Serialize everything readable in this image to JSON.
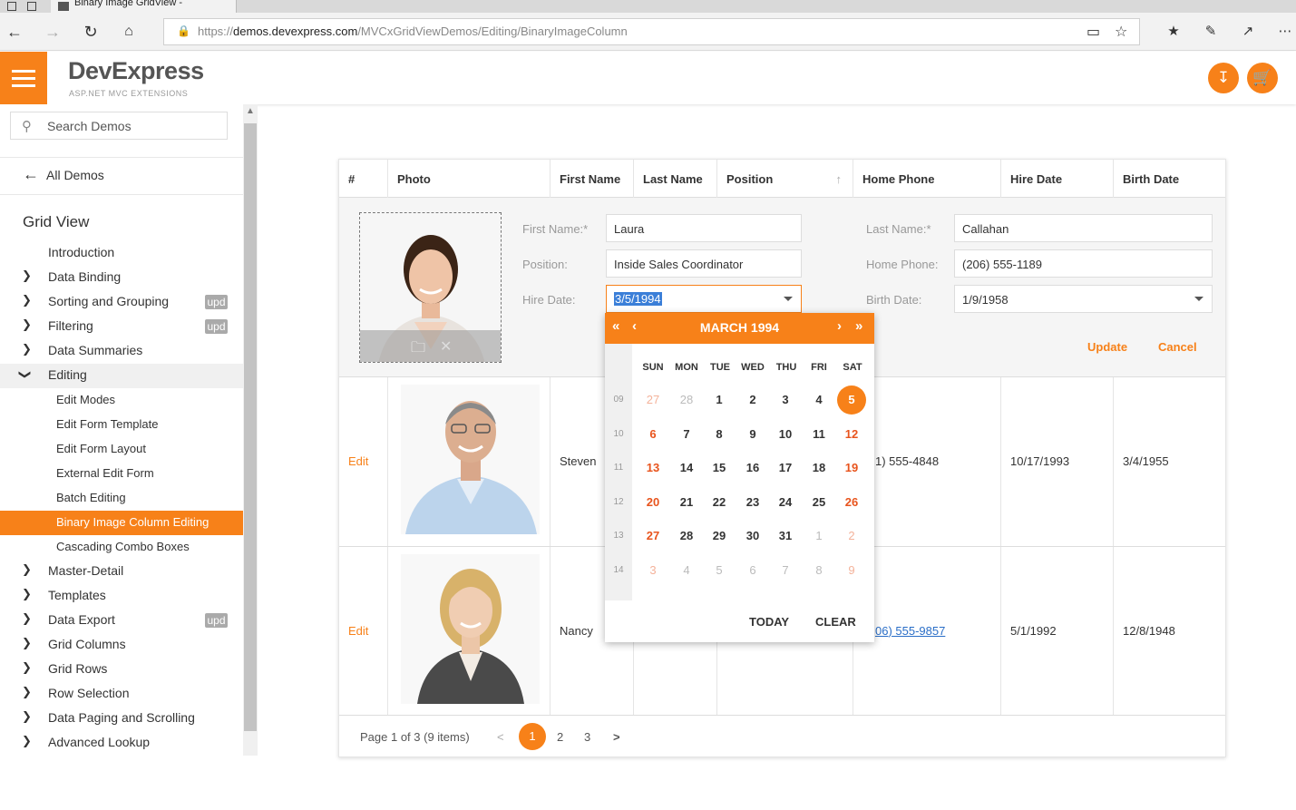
{
  "browser": {
    "tab_title": "Binary Image GridView -",
    "url_prefix": "https://",
    "url_domain": "demos.devexpress.com",
    "url_path": "/MVCxGridViewDemos/Editing/BinaryImageColumn"
  },
  "header": {
    "logo": "DevExpress",
    "sublogo": "ASP.NET MVC EXTENSIONS"
  },
  "sidebar": {
    "search_placeholder": "Search Demos",
    "all_demos": "All Demos",
    "section_title": "Grid View",
    "items": [
      {
        "label": "Introduction"
      },
      {
        "label": "Data Binding"
      },
      {
        "label": "Sorting and Grouping",
        "badge": "upd"
      },
      {
        "label": "Filtering",
        "badge": "upd"
      },
      {
        "label": "Data Summaries"
      },
      {
        "label": "Editing"
      },
      {
        "label": "Edit Modes"
      },
      {
        "label": "Edit Form Template"
      },
      {
        "label": "Edit Form Layout"
      },
      {
        "label": "External Edit Form"
      },
      {
        "label": "Batch Editing"
      },
      {
        "label": "Binary Image Column Editing"
      },
      {
        "label": "Cascading Combo Boxes"
      },
      {
        "label": "Master-Detail"
      },
      {
        "label": "Templates"
      },
      {
        "label": "Data Export",
        "badge": "upd"
      },
      {
        "label": "Grid Columns"
      },
      {
        "label": "Grid Rows"
      },
      {
        "label": "Row Selection"
      },
      {
        "label": "Data Paging and Scrolling"
      },
      {
        "label": "Advanced Lookup"
      }
    ]
  },
  "grid": {
    "columns": [
      "#",
      "Photo",
      "First Name",
      "Last Name",
      "Position",
      "Home Phone",
      "Hire Date",
      "Birth Date"
    ],
    "edit_form": {
      "first_name_label": "First Name:*",
      "first_name": "Laura",
      "last_name_label": "Last Name:*",
      "last_name": "Callahan",
      "position_label": "Position:",
      "position": "Inside Sales Coordinator",
      "home_phone_label": "Home Phone:",
      "home_phone": "(206) 555-1189",
      "hire_date_label": "Hire Date:",
      "hire_date": "3/5/1994",
      "birth_date_label": "Birth Date:",
      "birth_date": "1/9/1958",
      "update": "Update",
      "cancel": "Cancel"
    },
    "rows": [
      {
        "action": "Edit",
        "first_name": "Steven",
        "home_phone": "1) 555-4848",
        "hire_date": "10/17/1993",
        "birth_date": "3/4/1955"
      },
      {
        "action": "Edit",
        "first_name": "Nancy",
        "home_phone": "06) 555-9857",
        "hire_date": "5/1/1992",
        "birth_date": "12/8/1948"
      }
    ],
    "pager": {
      "info": "Page 1 of 3 (9 items)",
      "current": "1",
      "pages": [
        "2",
        "3"
      ],
      "prev": "<",
      "next": ">"
    }
  },
  "calendar": {
    "title": "MARCH 1994",
    "days_of_week": [
      "SUN",
      "MON",
      "TUE",
      "WED",
      "THU",
      "FRI",
      "SAT"
    ],
    "weeks": [
      {
        "num": "09",
        "days": [
          "27",
          "28",
          "1",
          "2",
          "3",
          "4",
          "5"
        ]
      },
      {
        "num": "10",
        "days": [
          "6",
          "7",
          "8",
          "9",
          "10",
          "11",
          "12"
        ]
      },
      {
        "num": "11",
        "days": [
          "13",
          "14",
          "15",
          "16",
          "17",
          "18",
          "19"
        ]
      },
      {
        "num": "12",
        "days": [
          "20",
          "21",
          "22",
          "23",
          "24",
          "25",
          "26"
        ]
      },
      {
        "num": "13",
        "days": [
          "27",
          "28",
          "29",
          "30",
          "31",
          "1",
          "2"
        ]
      },
      {
        "num": "14",
        "days": [
          "3",
          "4",
          "5",
          "6",
          "7",
          "8",
          "9"
        ]
      }
    ],
    "today": "TODAY",
    "clear": "CLEAR"
  }
}
